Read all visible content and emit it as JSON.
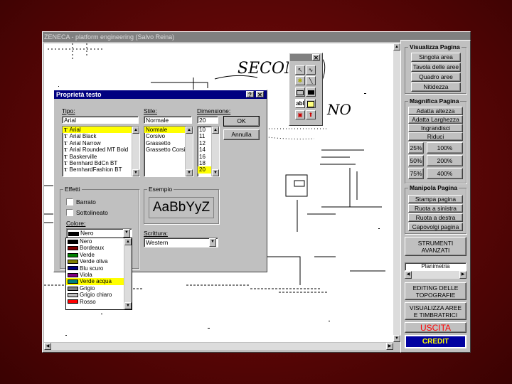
{
  "app": {
    "title": "ZENECA - platform engineering (Salvo Reina)"
  },
  "drawing": {
    "handwriting": [
      "SECON",
      "NO"
    ]
  },
  "dialog": {
    "title": "Proprietà testo",
    "help_label": "?",
    "close_label": "✕",
    "font_label": "Tipo:",
    "font_value": "Arial",
    "style_label": "Stile:",
    "style_value": "Normale",
    "size_label": "Dimensione:",
    "size_value": "20",
    "fonts": [
      "Arial",
      "Arial Black",
      "Arial Narrow",
      "Arial Rounded MT Bold",
      "Baskerville",
      "Bernhard BdCn BT",
      "BernhardFashion BT"
    ],
    "selected_font": "Arial",
    "styles": [
      "Normale",
      "Corsivo",
      "Grassetto",
      "Grassetto Corsivo"
    ],
    "selected_style": "Normale",
    "sizes": [
      "10",
      "11",
      "12",
      "14",
      "16",
      "18",
      "20"
    ],
    "selected_size": "20",
    "ok_label": "OK",
    "cancel_label": "Annulla",
    "effects_label": "Effetti",
    "strike_label": "Barrato",
    "underline_label": "Sottolineato",
    "color_label": "Colore:",
    "color_value": "Nero",
    "sample_label": "Esempio",
    "sample_text": "AaBbYyZ",
    "script_label": "Scrittura:",
    "script_value": "Western",
    "colors": [
      {
        "name": "Nero",
        "hex": "#000000"
      },
      {
        "name": "Bordeaux",
        "hex": "#800000"
      },
      {
        "name": "Verde",
        "hex": "#008000"
      },
      {
        "name": "Verde oliva",
        "hex": "#808000"
      },
      {
        "name": "Blu scuro",
        "hex": "#000080"
      },
      {
        "name": "Viola",
        "hex": "#800080"
      },
      {
        "name": "Verde acqua",
        "hex": "#008080"
      },
      {
        "name": "Grigio",
        "hex": "#808080"
      },
      {
        "name": "Grigio chiaro",
        "hex": "#c0c0c0"
      },
      {
        "name": "Rosso",
        "hex": "#ff0000"
      }
    ],
    "selected_color": "Verde acqua"
  },
  "toolbox": {
    "close_label": "✕",
    "tools": [
      "pointer-tool-icon",
      "freehand-tool-icon",
      "stamp-tool-icon",
      "line-tool-icon",
      "rectangle-tool-icon",
      "filled-rectangle-tool-icon",
      "text-tool-icon",
      "note-tool-icon",
      "image-tool-icon",
      "export-tool-icon"
    ],
    "text_tool_label": "abl"
  },
  "sidebar": {
    "visualizza": {
      "title": "Visualizza Pagina",
      "buttons": [
        "Singola area",
        "Tavola delle aree",
        "Quadro aree",
        "Nitidezza"
      ]
    },
    "magnifica": {
      "title": "Magnifica Pagina",
      "buttons": [
        "Adatta altezza",
        "Adatta Larghezza",
        "Ingrandisci",
        "Riduci"
      ],
      "zoom": [
        "25%",
        "100%",
        "50%",
        "200%",
        "75%",
        "400%"
      ]
    },
    "manipola": {
      "title": "Manipola Pagina",
      "buttons": [
        "Stampa pagina",
        "Ruota a sinistra",
        "Ruota a destra",
        "Capovolgi pagina"
      ]
    },
    "strumenti_label": "STRUMENTI AVANZATI",
    "planimetria_label": "Planimetria",
    "editing_label": "EDITING DELLE TOPOGRAFIE",
    "visualizza_aree_label": "VISUALIZZA AREE E TIMBRATRICI",
    "uscita_label": "USCITA",
    "credit_label": "CREDIT",
    "accent_red": "#ff0000",
    "credit_bg": "#0000a0",
    "credit_fg": "#ffff00"
  },
  "colors": {
    "titlebar": "#000080",
    "selection": "#ffff00",
    "face": "#c0c0c0"
  }
}
